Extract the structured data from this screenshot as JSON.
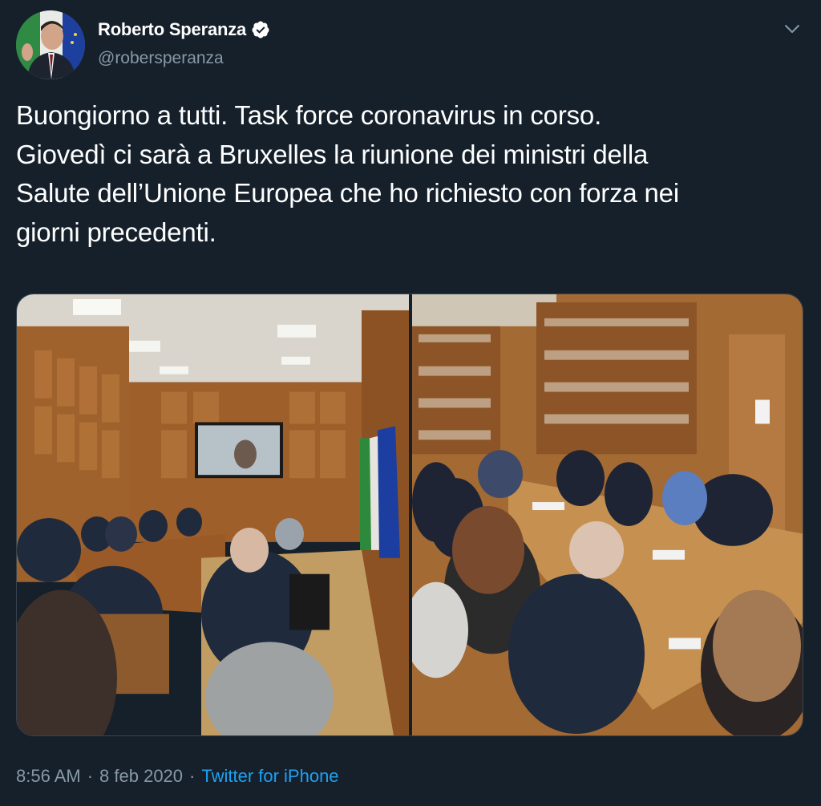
{
  "author": {
    "display_name": "Roberto Speranza",
    "handle": "@robersperanza",
    "verified_icon": "verified-badge-icon"
  },
  "tweet": {
    "text_lines": [
      "Buongiorno a tutti. Task force coronavirus in corso.",
      "Giovedì ci sarà a Bruxelles la riunione dei ministri della",
      "Salute dell’Unione Europea che ho richiesto con forza nei",
      "giorni precedenti."
    ]
  },
  "meta": {
    "time": "8:56 AM",
    "separator": "·",
    "date": "8 feb 2020",
    "source": "Twitter for iPhone"
  },
  "colors": {
    "background": "#15202b",
    "secondary_text": "#8899a6",
    "accent": "#1da1f2"
  },
  "icons": {
    "menu": "chevron-down-icon",
    "verified": "verified-badge-icon"
  }
}
